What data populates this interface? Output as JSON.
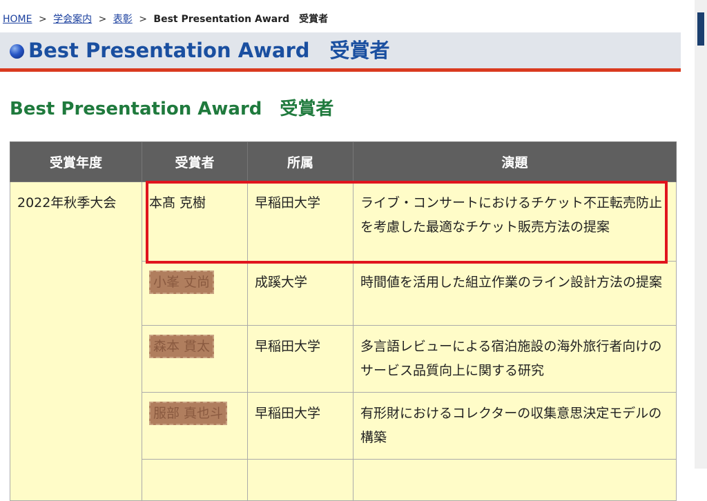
{
  "breadcrumb": {
    "home": "HOME",
    "sep": ">",
    "about": "学会案内",
    "awards": "表彰",
    "current": "Best Presentation Award　受賞者"
  },
  "page_title": "Best Presentation Award　受賞者",
  "section_heading": "Best Presentation Award　受賞者",
  "table": {
    "headers": [
      "受賞年度",
      "所属",
      "演題",
      "受賞者"
    ],
    "year": "2022年秋季大会",
    "rows": [
      {
        "name": "本髙 克樹",
        "affiliation": "早稲田大学",
        "title": "ライブ・コンサートにおけるチケット不正転売防止を考慮した最適なチケット販売方法の提案"
      },
      {
        "name": "小峯 丈尚",
        "affiliation": "成蹊大学",
        "title": "時間値を活用した組立作業のライン設計方法の提案"
      },
      {
        "name": "森本 貫太",
        "affiliation": "早稲田大学",
        "title": "多言語レビューによる宿泊施設の海外旅行者向けのサービス品質向上に関する研究"
      },
      {
        "name": "服部 真也斗",
        "affiliation": "早稲田大学",
        "title": "有形財におけるコレクターの収集意思決定モデルの構築"
      },
      {
        "name": "",
        "affiliation": "",
        "title": ""
      }
    ]
  },
  "colors": {
    "title_text": "#1a4fa0",
    "title_underline": "#d93a1f",
    "sub_heading": "#1f7a3d",
    "table_header_bg": "#5f5f5f",
    "table_cell_bg": "#fffcc8",
    "highlight": "#e0141e"
  }
}
